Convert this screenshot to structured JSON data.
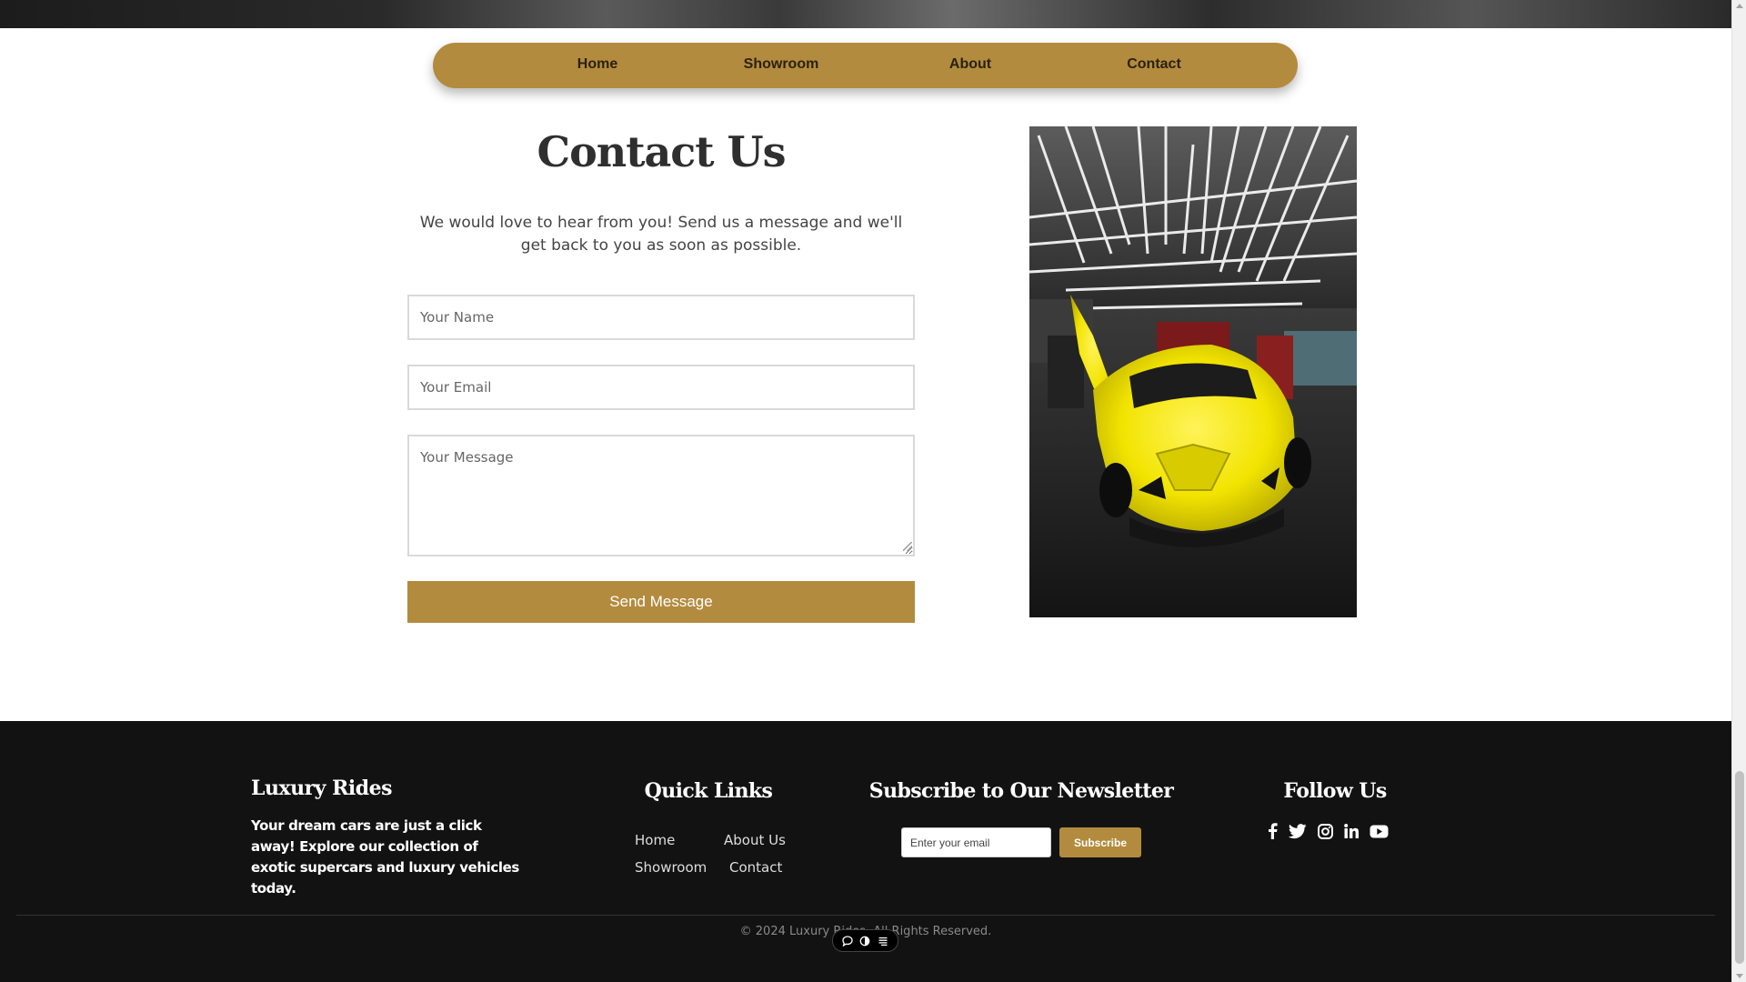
{
  "nav": {
    "items": [
      {
        "label": "Home"
      },
      {
        "label": "Showroom"
      },
      {
        "label": "About"
      },
      {
        "label": "Contact"
      }
    ]
  },
  "contact": {
    "title": "Contact Us",
    "intro": "We would love to hear from you! Send us a message and we'll get back to you as soon as possible.",
    "name_placeholder": "Your Name",
    "email_placeholder": "Your Email",
    "message_placeholder": "Your Message",
    "send_label": "Send Message"
  },
  "footer": {
    "brand": "Luxury Rides",
    "tagline": "Your dream cars are just a click away! Explore our collection of exotic supercars and luxury vehicles today.",
    "quick_links": {
      "heading": "Quick Links",
      "links": [
        "Home",
        "About Us",
        "Showroom",
        "Contact"
      ]
    },
    "newsletter": {
      "heading": "Subscribe to Our Newsletter",
      "email_placeholder": "Enter your email",
      "button_label": "Subscribe"
    },
    "follow": {
      "heading": "Follow Us",
      "icons": [
        "facebook-icon",
        "twitter-icon",
        "instagram-icon",
        "linkedin-icon",
        "youtube-icon"
      ]
    },
    "copyright": "© 2024 Luxury Rides. All Rights Reserved."
  },
  "theme": {
    "accent": "#b38b3e",
    "footer_bg": "#121212",
    "car_color": "#f2e400"
  }
}
